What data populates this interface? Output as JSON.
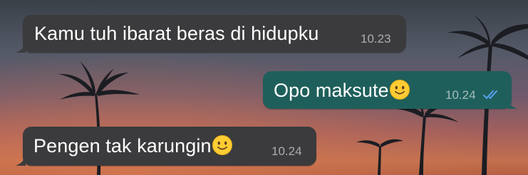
{
  "colors": {
    "incoming_bubble": "#3b3b3d",
    "outgoing_bubble": "#1f5f5b",
    "read_ticks": "#5ea8ff"
  },
  "messages": [
    {
      "direction": "incoming",
      "text": "Kamu tuh ibarat beras di hidupku",
      "time": "10.23",
      "emoji": ""
    },
    {
      "direction": "outgoing",
      "text": "Opo maksute",
      "time": "10.24",
      "emoji": "slightly-smiling-face",
      "status": "read"
    },
    {
      "direction": "incoming",
      "text": "Pengen tak karungin",
      "time": "10.24",
      "emoji": "slightly-smiling-face"
    }
  ]
}
